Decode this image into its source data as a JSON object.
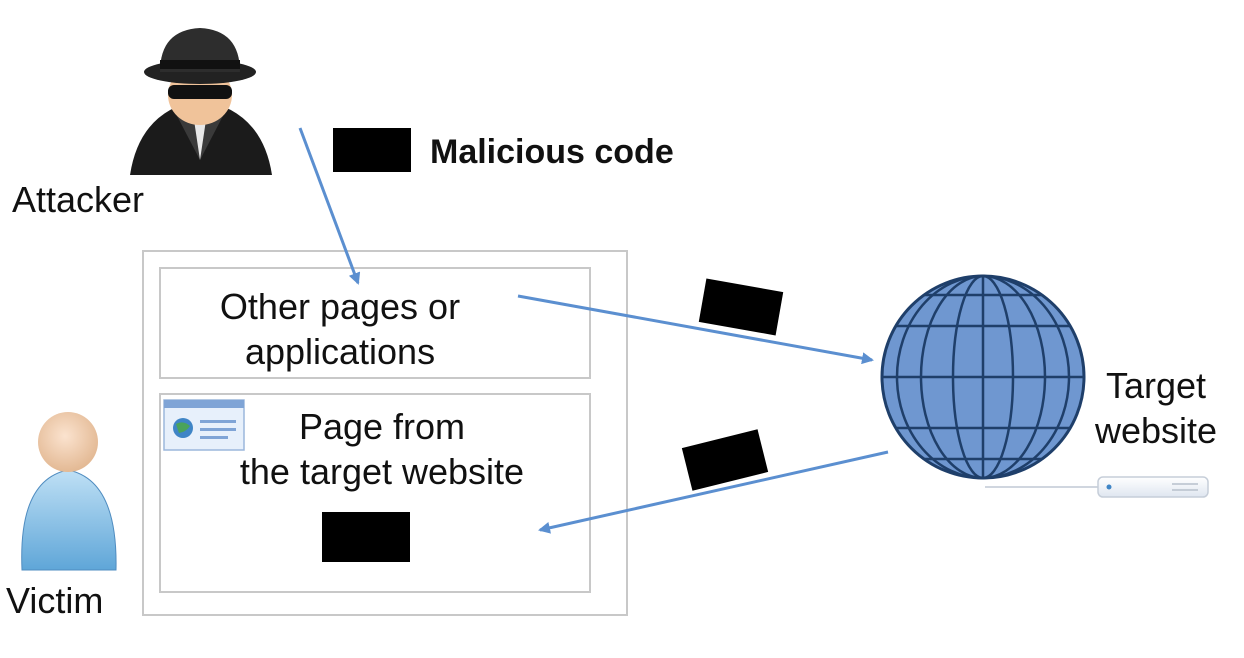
{
  "legend": {
    "label": "Malicious code"
  },
  "actors": {
    "attacker": {
      "label": "Attacker"
    },
    "victim": {
      "label": "Victim"
    },
    "target": {
      "line1": "Target",
      "line2": "website"
    }
  },
  "browser": {
    "other_pages": {
      "line1": "Other pages or",
      "line2": "applications"
    },
    "target_page": {
      "line1": "Page from",
      "line2": "the target website"
    }
  },
  "colors": {
    "arrow": "#5b8fd0",
    "globe": "#6f97d0",
    "globe_stroke": "#1f3f6a",
    "code_block": "#000000",
    "box_border": "#c8c8c8"
  }
}
